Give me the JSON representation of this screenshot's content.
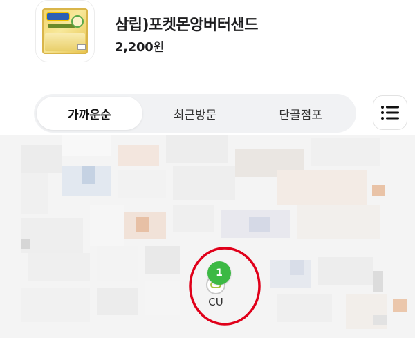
{
  "product": {
    "name": "삼립)포켓몬앙버터샌드",
    "price": "2,200",
    "price_unit": "원",
    "thumb_icon": "product-image"
  },
  "tabs": [
    {
      "label": "가까운순",
      "active": true
    },
    {
      "label": "최근방문",
      "active": false
    },
    {
      "label": "단골점포",
      "active": false
    }
  ],
  "list_button_icon": "list-icon",
  "map": {
    "store": {
      "count": "1",
      "label": "CU",
      "badge_color": "#3cb944",
      "highlight_color": "#e0001a"
    }
  }
}
